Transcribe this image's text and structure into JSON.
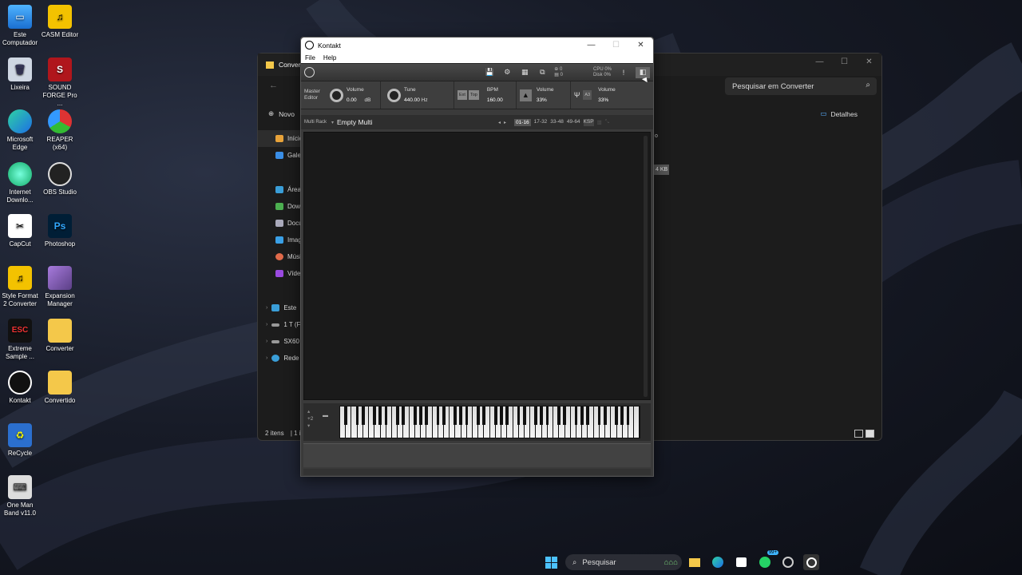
{
  "desktop": {
    "icons": [
      {
        "label": "Este Computador"
      },
      {
        "label": "CASM Editor"
      },
      {
        "label": "Lixeira"
      },
      {
        "label": "SOUND FORGE Pro ..."
      },
      {
        "label": "Microsoft Edge"
      },
      {
        "label": "REAPER (x64)"
      },
      {
        "label": "Internet Downlo..."
      },
      {
        "label": "OBS Studio"
      },
      {
        "label": "CapCut"
      },
      {
        "label": "Photoshop"
      },
      {
        "label": "Style Format 2 Converter"
      },
      {
        "label": "Expansion Manager"
      },
      {
        "label": "Extreme Sample ..."
      },
      {
        "label": "Converter"
      },
      {
        "label": "Kontakt"
      },
      {
        "label": "Convertido"
      },
      {
        "label": "ReCycle"
      },
      {
        "label": "One Man Band v11.0"
      }
    ]
  },
  "explorer": {
    "title": "Conver",
    "search_placeholder": "Pesquisar em Converter",
    "new_label": "Novo",
    "details_label": "Detalhes",
    "nav_items": [
      {
        "label": "Início"
      },
      {
        "label": "Galeria"
      },
      {
        "label": "Área"
      },
      {
        "label": "Downl"
      },
      {
        "label": "Docu"
      },
      {
        "label": "Imag"
      },
      {
        "label": "Músi"
      },
      {
        "label": "Vídeo"
      },
      {
        "label": "Este"
      },
      {
        "label": "1 T (F"
      },
      {
        "label": "SX60"
      },
      {
        "label": "Rede"
      }
    ],
    "status_text": "2 itens",
    "status_sep": "1 i",
    "size_text": "4 KB",
    "col_fragment": "o"
  },
  "kontakt": {
    "title": "Kontakt",
    "menu": [
      "File",
      "Help"
    ],
    "io": {
      "in": "0",
      "out": "0"
    },
    "cpu": {
      "cpu_label": "CPU",
      "cpu_val": "0%",
      "disk_label": "Disk",
      "disk_val": "0%"
    },
    "master": {
      "label": "Master Editor",
      "volume_label": "Volume",
      "volume_value": "0.00",
      "volume_unit": "dB",
      "tune_label": "Tune",
      "tune_value": "440.00",
      "tune_unit": "Hz",
      "ext_label": "Ext",
      "top_label": "Top",
      "bpm_label": "BPM",
      "bpm_value": "160.00",
      "metro_volume_label": "Volume",
      "metro_volume_value": "33%",
      "ref_label": "A3",
      "ref_volume_label": "Volume",
      "ref_volume_value": "33%"
    },
    "rack": {
      "type_label": "Multi Rack",
      "multi_name": "Empty Multi",
      "pages": [
        "01-16",
        "17-32",
        "33-48",
        "49-64",
        "KSP"
      ]
    },
    "keyboard": {
      "octave": "+2"
    }
  },
  "taskbar": {
    "search_label": "Pesquisar",
    "badge": "99+"
  }
}
